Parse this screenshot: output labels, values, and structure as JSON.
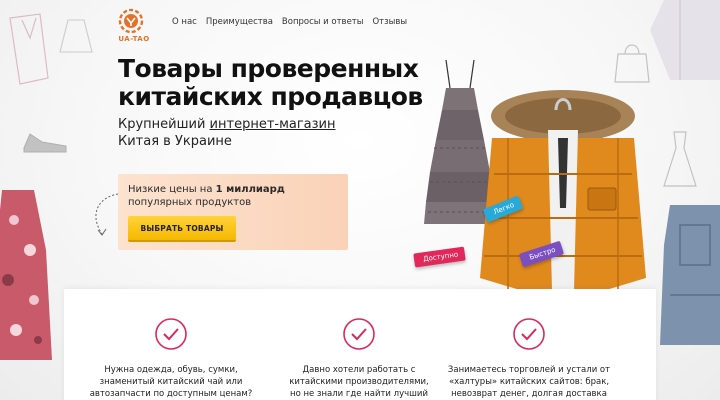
{
  "brand": {
    "logo_text": "UA-TAO",
    "accent": "#e1742d"
  },
  "nav": {
    "items": [
      "О нас",
      "Преимущества",
      "Вопросы и ответы",
      "Отзывы"
    ]
  },
  "hero": {
    "title_line1": "Товары проверенных",
    "title_line2": "китайских продавцов",
    "sub_part1": "Крупнейший ",
    "sub_link": "интернет-магазин",
    "sub_line2": "Китая в Украине"
  },
  "offer": {
    "text_part1": "Низкие цены на ",
    "text_bold": "1 миллиард",
    "text_line2": "популярных продуктов",
    "cta_label": "ВЫБРАТЬ ТОВАРЫ",
    "bg_color": "#fad2b8",
    "cta_color": "#f5b800"
  },
  "tags": {
    "easy": "Легко",
    "accessible": "Доступно",
    "fast": "Быстро"
  },
  "features": [
    {
      "line1": "Нужна одежда, обувь, сумки,",
      "line2": "знаменитый китайский чай или",
      "line3": "автозапчасти по доступным ценам?"
    },
    {
      "line1": "Давно хотели работать с",
      "line2": "китайскими производителями,",
      "line3": "но не знали где найти лучший"
    },
    {
      "line1": "Занимаетесь торговлей и устали от",
      "line2": "«халтуры» китайских сайтов: брак,",
      "line3": "невозврат денег, долгая доставка"
    }
  ],
  "icons": {
    "logo": "ua-tao-logo-icon",
    "check": "check-circle-icon"
  },
  "colors": {
    "check": "#d9295c"
  }
}
